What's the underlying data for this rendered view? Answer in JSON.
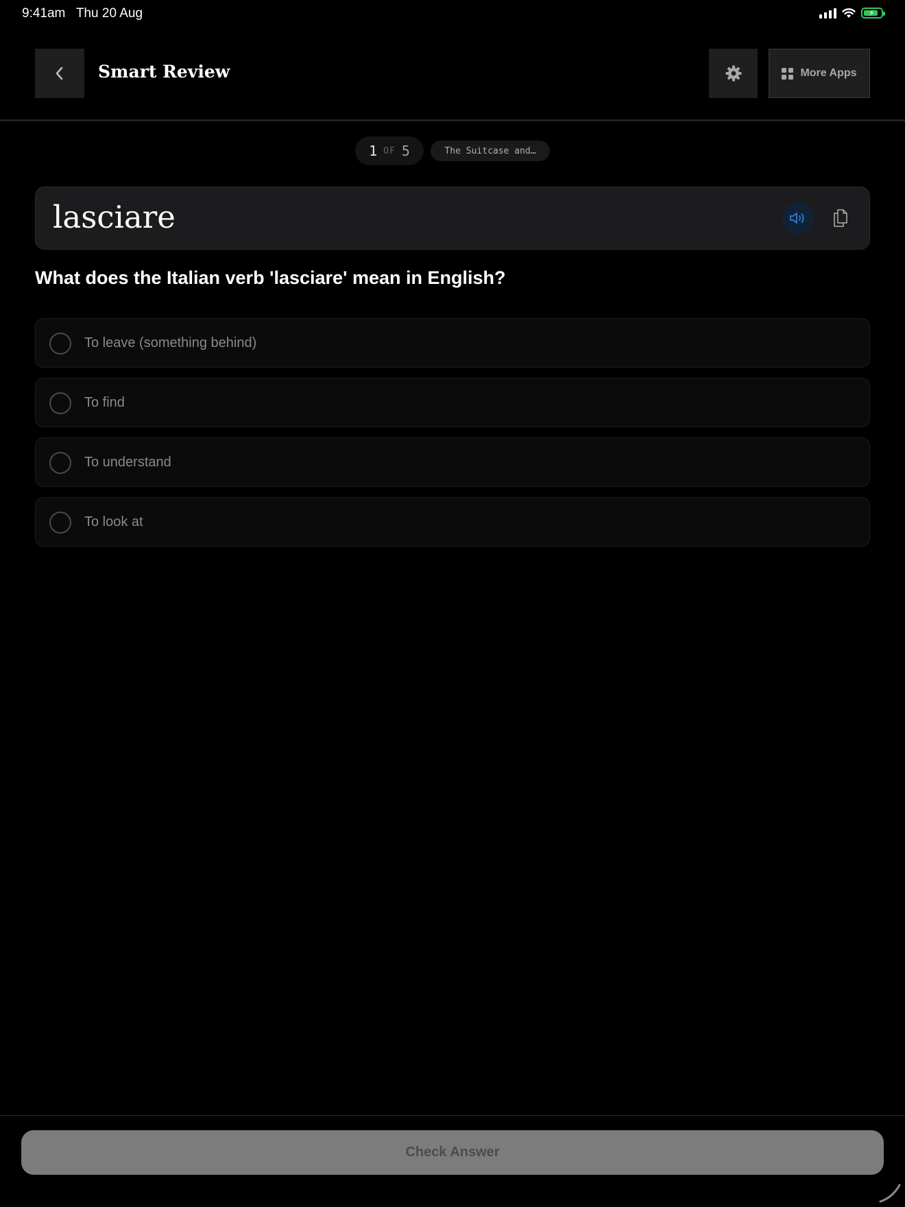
{
  "status_bar": {
    "time_date": "9:41am   Thu 20 Aug",
    "battery_color": "#34c759"
  },
  "header": {
    "title": "Smart Review",
    "back_icon": "chevron-left-icon",
    "settings_icon": "gear-icon",
    "more_apps_label": "More Apps",
    "more_apps_icon": "grid-icon"
  },
  "progress": {
    "current": "1",
    "of_label": "OF",
    "total": "5",
    "lesson": "The Suitcase and…"
  },
  "word_card": {
    "word": "lasciare",
    "speak_icon": "speaker-icon",
    "copy_icon": "copy-icon",
    "accent_color": "#2f7ed8"
  },
  "question": "What does the Italian verb 'lasciare' mean in English?",
  "options": [
    {
      "label": "To leave (something behind)"
    },
    {
      "label": "To find"
    },
    {
      "label": "To understand"
    },
    {
      "label": "To look at"
    }
  ],
  "footer": {
    "check_answer_label": "Check Answer"
  }
}
